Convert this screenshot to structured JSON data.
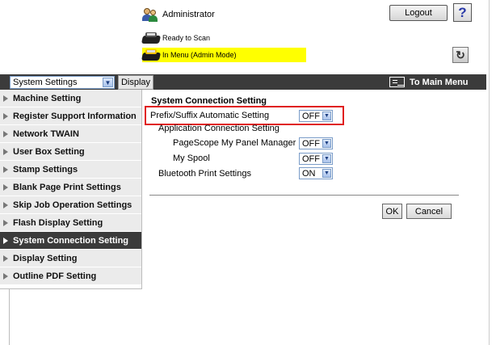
{
  "header": {
    "user_label": "Administrator",
    "logout_label": "Logout",
    "help_label": "?",
    "status_ready": "Ready to Scan",
    "status_mode": "In Menu (Admin Mode)",
    "refresh_symbol": "↻"
  },
  "toolbar": {
    "category_value": "System Settings",
    "display_label": "Display",
    "main_menu_label": "To Main Menu"
  },
  "sidebar": {
    "items": [
      {
        "label": "Machine Setting"
      },
      {
        "label": "Register Support Information"
      },
      {
        "label": "Network TWAIN"
      },
      {
        "label": "User Box Setting"
      },
      {
        "label": "Stamp Settings"
      },
      {
        "label": "Blank Page Print Settings"
      },
      {
        "label": "Skip Job Operation Settings"
      },
      {
        "label": "Flash Display Setting"
      },
      {
        "label": "System Connection Setting"
      },
      {
        "label": "Display Setting"
      },
      {
        "label": "Outline PDF Setting"
      }
    ],
    "active_index": 8
  },
  "main": {
    "title": "System Connection Setting",
    "prefix_label": "Prefix/Suffix Automatic Setting",
    "prefix_value": "OFF",
    "app_conn_label": "Application Connection Setting",
    "pagescope_label": "PageScope My Panel Manager",
    "pagescope_value": "OFF",
    "myspool_label": "My Spool",
    "myspool_value": "OFF",
    "bluetooth_label": "Bluetooth Print Settings",
    "bluetooth_value": "ON",
    "ok_label": "OK",
    "cancel_label": "Cancel"
  },
  "colors": {
    "highlight_border": "#e01e1e",
    "mode_banner": "#ffff00",
    "dark_bar": "#3b3b3b"
  }
}
